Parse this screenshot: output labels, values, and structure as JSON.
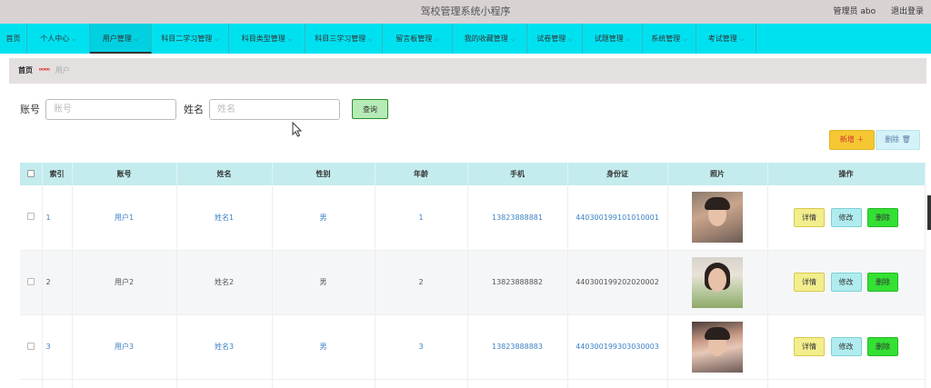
{
  "app": {
    "title": "驾校管理系统小程序",
    "user_label": "管理员 abo",
    "logout_label": "退出登录"
  },
  "nav": [
    {
      "label": "首页",
      "caret": false,
      "active": false
    },
    {
      "label": "个人中心",
      "caret": true,
      "active": false
    },
    {
      "label": "用户管理",
      "caret": true,
      "active": true
    },
    {
      "label": "科目二学习管理",
      "caret": true,
      "active": false
    },
    {
      "label": "科目类型管理",
      "caret": true,
      "active": false
    },
    {
      "label": "科目三学习管理",
      "caret": true,
      "active": false
    },
    {
      "label": "留言板管理",
      "caret": true,
      "active": false
    },
    {
      "label": "我的收藏管理",
      "caret": true,
      "active": false
    },
    {
      "label": "试卷管理",
      "caret": true,
      "active": false
    },
    {
      "label": "试题管理",
      "caret": true,
      "active": false
    },
    {
      "label": "系统管理",
      "caret": true,
      "active": false
    },
    {
      "label": "考试管理",
      "caret": true,
      "active": false
    }
  ],
  "breadcrumb": {
    "home": "首页",
    "separator": "ᵒᵒᵒᵒ",
    "current": "用户"
  },
  "search": {
    "account_label": "账号",
    "account_placeholder": "账号",
    "account_value": "",
    "name_label": "姓名",
    "name_placeholder": "姓名",
    "name_value": "",
    "query_label": "查询"
  },
  "actions": {
    "add_label": "新增 ＋",
    "delete_label": "删除 🗑"
  },
  "table": {
    "headers": [
      "",
      "索引",
      "账号",
      "姓名",
      "性别",
      "年龄",
      "手机",
      "身份证",
      "照片",
      "操作"
    ],
    "op_labels": {
      "detail": "详情",
      "edit": "修改",
      "delete": "删除"
    },
    "rows": [
      {
        "index": "1",
        "account": "用户1",
        "name": "姓名1",
        "gender": "男",
        "age": "1",
        "phone": "13823888881",
        "idcard": "440300199101010001",
        "photo": "portrait-young-man"
      },
      {
        "index": "2",
        "account": "用户2",
        "name": "姓名2",
        "gender": "男",
        "age": "2",
        "phone": "13823888882",
        "idcard": "440300199202020002",
        "photo": "portrait-young-woman"
      },
      {
        "index": "3",
        "account": "用户3",
        "name": "姓名3",
        "gender": "男",
        "age": "3",
        "phone": "13823888883",
        "idcard": "440300199303030003",
        "photo": "portrait-young-man-2"
      }
    ]
  },
  "colors": {
    "nav_bg": "#00e1f0",
    "header_bg": "#c4ecee",
    "link_blue": "#3d82c4",
    "add_yellow": "#f5c833",
    "delete_green": "#34e034"
  }
}
